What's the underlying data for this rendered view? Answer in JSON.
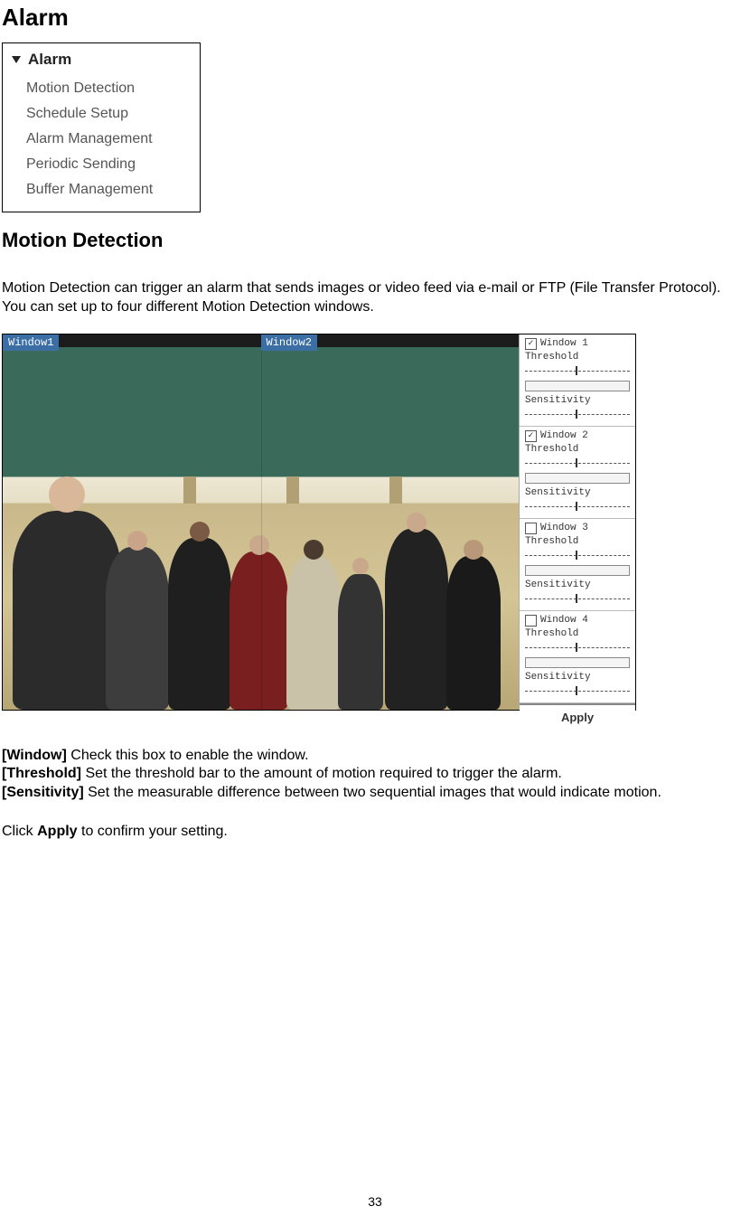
{
  "title": "Alarm",
  "menu": {
    "header": "Alarm",
    "items": [
      "Motion Detection",
      "Schedule Setup",
      "Alarm Management",
      "Periodic Sending",
      "Buffer Management"
    ]
  },
  "section_heading": "Motion Detection",
  "intro": "Motion Detection can trigger an alarm that sends images or video feed via e-mail or FTP (File Transfer Protocol). You can set up to four different Motion Detection windows.",
  "screenshot": {
    "video_labels": {
      "w1": "Window1",
      "w2": "Window2"
    },
    "panels": [
      {
        "checked": true,
        "title": "Window 1",
        "l1": "Threshold",
        "l2": "Sensitivity"
      },
      {
        "checked": true,
        "title": "Window 2",
        "l1": "Threshold",
        "l2": "Sensitivity"
      },
      {
        "checked": false,
        "title": "Window 3",
        "l1": "Threshold",
        "l2": "Sensitivity"
      },
      {
        "checked": false,
        "title": "Window 4",
        "l1": "Threshold",
        "l2": "Sensitivity"
      }
    ],
    "apply": "Apply"
  },
  "defs": {
    "window_b": "[Window]",
    "window_t": " Check this box to enable the window.",
    "threshold_b": "[Threshold]",
    "threshold_t": " Set the threshold bar to the amount of motion required to trigger the alarm.",
    "sensitivity_b": "[Sensitivity]",
    "sensitivity_t": " Set the measurable difference between two sequential images that would indicate motion."
  },
  "closing": {
    "pre": "Click ",
    "bold": "Apply",
    "post": " to confirm your setting."
  },
  "page_number": "33"
}
